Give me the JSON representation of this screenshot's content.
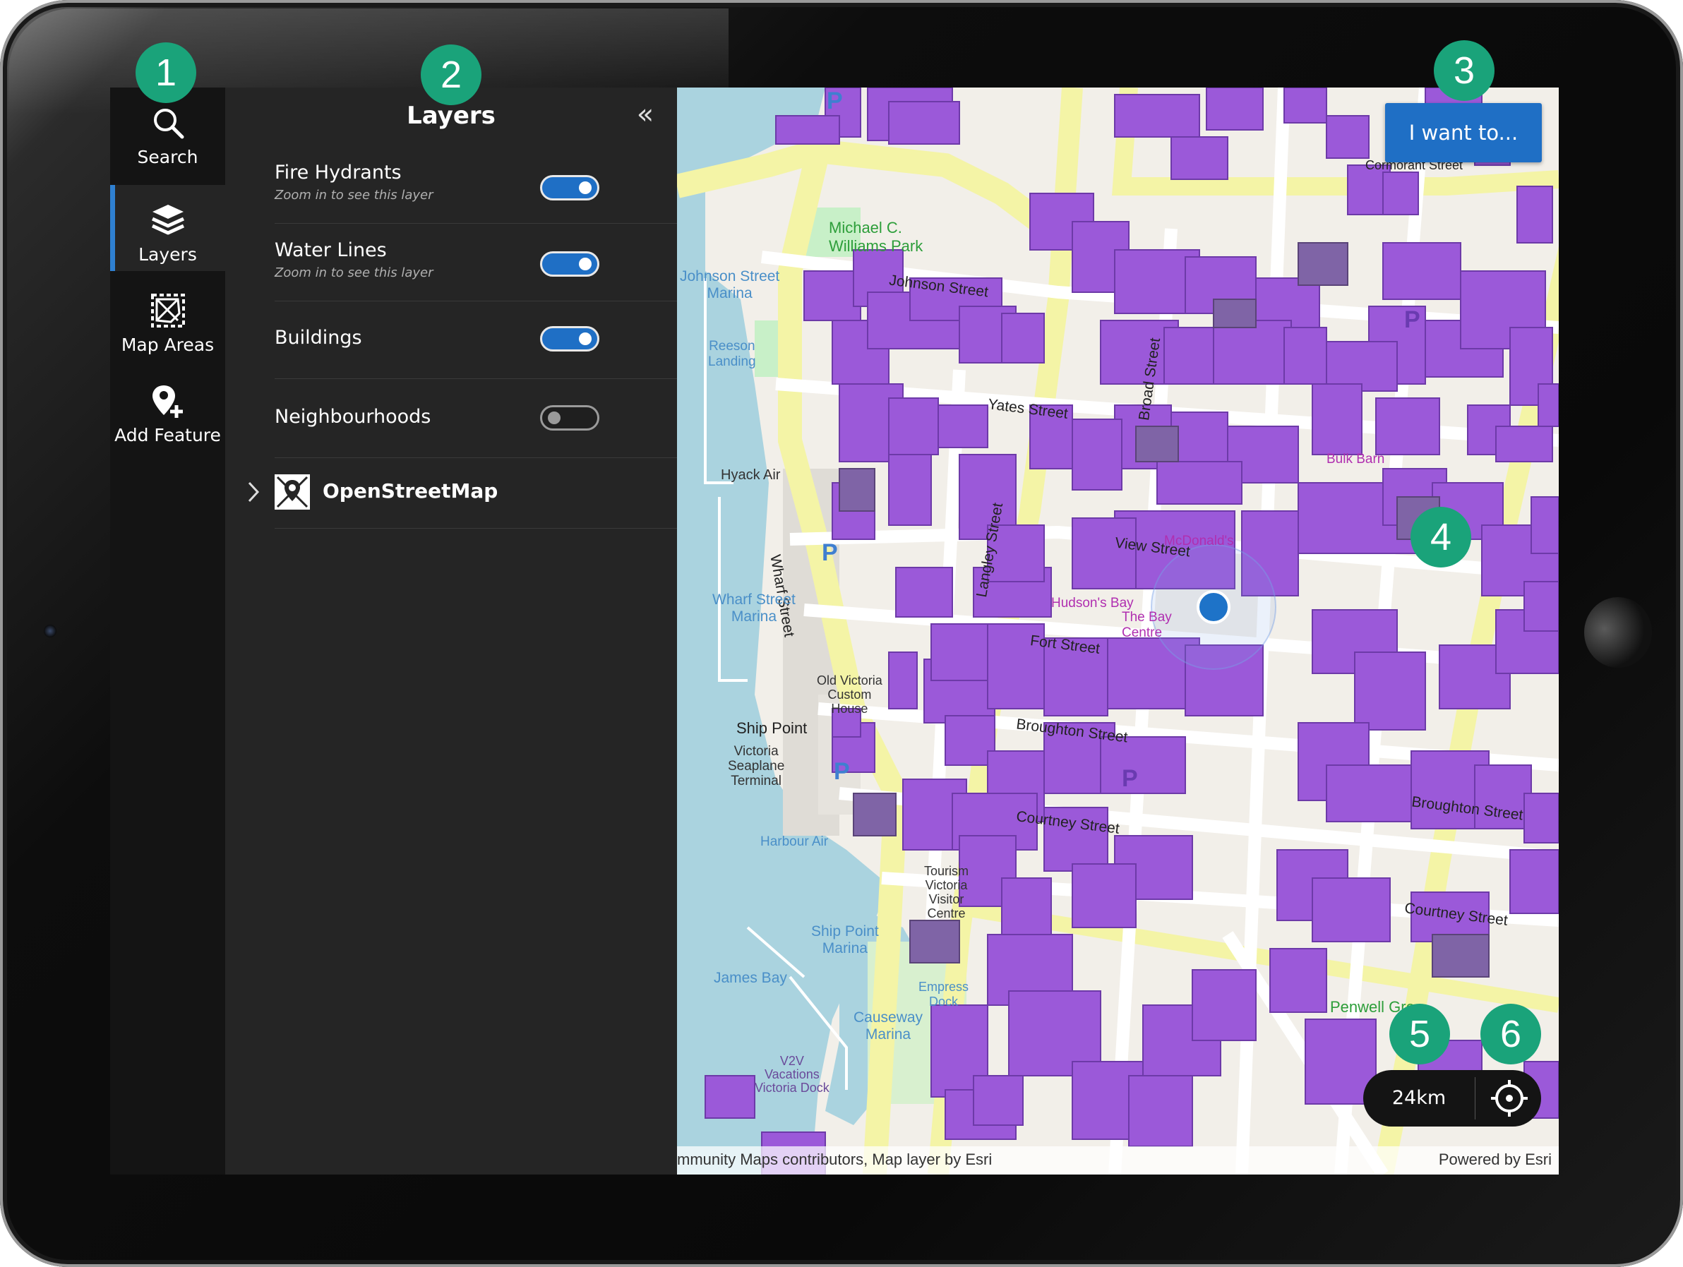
{
  "nav": {
    "items": [
      {
        "label": "Search",
        "icon": "search-icon"
      },
      {
        "label": "Layers",
        "icon": "layers-icon",
        "active": true
      },
      {
        "label": "Map Areas",
        "icon": "map-areas-icon"
      },
      {
        "label": "Add Feature",
        "icon": "add-feature-icon"
      }
    ]
  },
  "panel": {
    "title": "Layers",
    "collapse_icon": "«",
    "layers": [
      {
        "name": "Fire Hydrants",
        "note": "Zoom in to see this layer",
        "visible": true
      },
      {
        "name": "Water Lines",
        "note": "Zoom in to see this layer",
        "visible": true
      },
      {
        "name": "Buildings",
        "note": "",
        "visible": true
      },
      {
        "name": "Neighbourhoods",
        "note": "",
        "visible": false
      }
    ],
    "basemap": {
      "name": "OpenStreetMap",
      "icon": "osm-icon"
    }
  },
  "map": {
    "i_want_to": "I want to...",
    "scale": "24km",
    "attribution_left": "mmunity Maps contributors, Map layer by Esri",
    "attribution_right": "Powered by Esri",
    "streets": [
      "Johnson Street",
      "Yates Street",
      "View Street",
      "Fort Street",
      "Broughton Street",
      "Courtney Street",
      "Wharf Street",
      "Langley Street",
      "Broad Street",
      "Cormorant Street"
    ],
    "places": {
      "johnson_marina": "Johnson Street\nMarina",
      "reeson": "Reeson\nLanding",
      "hyack": "Hyack Air",
      "wharf_marina": "Wharf Street\nMarina",
      "ship_point": "Ship Point",
      "seaplane": "Victoria\nSeaplane\nTerminal",
      "harbour_air": "Harbour Air",
      "ship_point_marina": "Ship Point\nMarina",
      "james_bay": "James Bay",
      "causeway": "Causeway\nMarina",
      "v2v": "V2V\nVacations\nVictoria Dock",
      "empress": "Empress\nDock",
      "tourism": "Tourism\nVictoria\nVisitor\nCentre",
      "michael": "Michael C.\nWilliams Park",
      "penwell": "Penwell Gre",
      "old_customs": "Old Victoria\nCustom\nHouse",
      "bulk_barn": "Bulk Barn",
      "bay": "The Bay\nCentre",
      "mcdonalds": "McDonald's",
      "bay_label": "Hudson's Bay"
    },
    "colors": {
      "building": "#9b59d9",
      "road_major": "#f4f4a6",
      "water": "#aad3df",
      "accent": "#1f6fc5",
      "callout": "#1aa37a"
    }
  },
  "callouts": [
    "1",
    "2",
    "3",
    "4",
    "5",
    "6"
  ]
}
